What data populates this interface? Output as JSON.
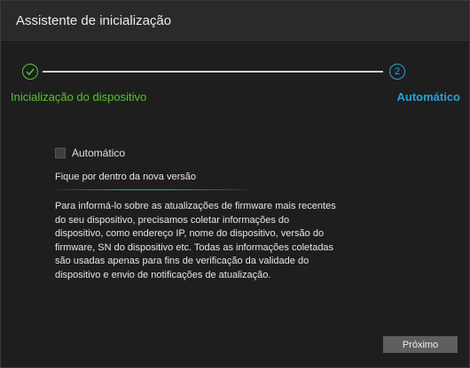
{
  "window": {
    "title": "Assistente de inicialização"
  },
  "steps": [
    {
      "number": "",
      "label": "Inicialização do dispositivo",
      "status": "done",
      "icon": "check-icon",
      "color": "#55c435"
    },
    {
      "number": "2",
      "label": "Automático",
      "status": "current",
      "color": "#2a9fd6"
    }
  ],
  "auto_update": {
    "checkbox_label": "Automático",
    "checked": false,
    "subtitle": "Fique por dentro da nova versão",
    "description": "Para informá-lo sobre as atualizações de firmware mais recentes do seu dispositivo, precisamos coletar informações do dispositivo, como endereço IP, nome do dispositivo, versão do firmware, SN do dispositivo etc. Todas as informações coletadas são usadas apenas para fins de verificação da validade do dispositivo e envio de notificações de atualização."
  },
  "footer": {
    "next_label": "Próximo"
  }
}
